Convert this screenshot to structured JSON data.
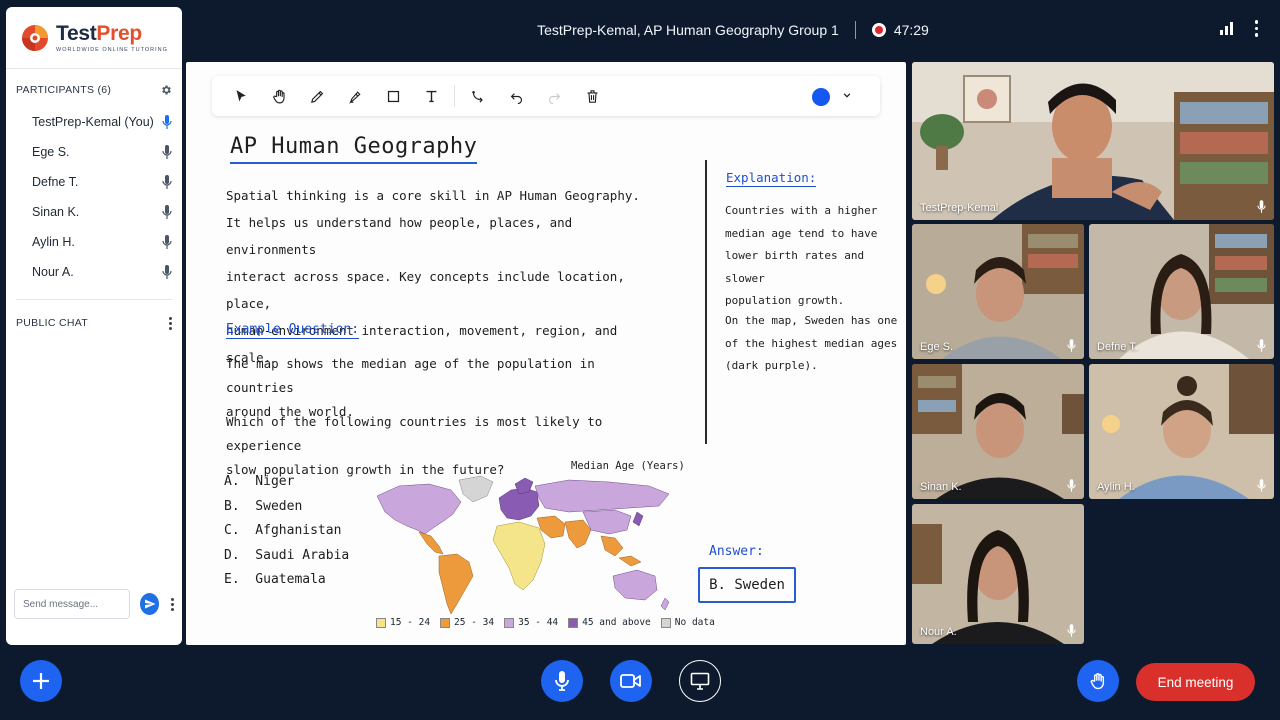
{
  "meeting": {
    "title": "TestPrep-Kemal, AP Human Geography Group 1",
    "timer": "47:29"
  },
  "brand": {
    "name_part1": "Test",
    "name_part2": "Prep",
    "tagline": "WORLDWIDE ONLINE TUTORING"
  },
  "participants": {
    "header": "PARTICIPANTS (6)",
    "list": [
      {
        "name": "TestPrep-Kemal (You)",
        "mic_color": "#1f6fe5"
      },
      {
        "name": "Ege S.",
        "mic_color": "#4b5563"
      },
      {
        "name": "Defne T.",
        "mic_color": "#4b5563"
      },
      {
        "name": "Sinan K.",
        "mic_color": "#4b5563"
      },
      {
        "name": "Aylin H.",
        "mic_color": "#4b5563"
      },
      {
        "name": "Nour A.",
        "mic_color": "#4b5563"
      }
    ]
  },
  "chat": {
    "header": "PUBLIC CHAT",
    "placeholder": "Send message..."
  },
  "board": {
    "title": "AP Human Geography",
    "intro_lines": [
      "Spatial thinking is a core skill in AP Human Geography.",
      "It helps us understand how people, places, and environments",
      "interact across space. Key concepts include location, place,",
      "human-environment interaction, movement, region, and scale."
    ],
    "example_label": "Example Question:",
    "question_lines": [
      "The map shows the median age of the population in countries",
      "around the world."
    ],
    "question2_lines": [
      "Which of the following countries is most likely to experience",
      "slow population growth in the future?"
    ],
    "options": [
      "A.  Niger",
      "B.  Sweden",
      "C.  Afghanistan",
      "D.  Saudi Arabia",
      "E.  Guatemala"
    ],
    "explanation_label": "Explanation:",
    "explanation_lines_1": [
      "Countries with a higher",
      "median age tend to have",
      "lower birth rates and slower",
      "population growth."
    ],
    "explanation_lines_2": [
      "On the map, Sweden has one",
      "of the highest median ages",
      "(dark purple)."
    ],
    "map_title": "Median Age (Years)",
    "legend": [
      {
        "label": "15 - 24",
        "color": "#f5e58a"
      },
      {
        "label": "25 - 34",
        "color": "#ec9a3c"
      },
      {
        "label": "35 - 44",
        "color": "#c9a6dc"
      },
      {
        "label": "45 and above",
        "color": "#8a5bb3"
      },
      {
        "label": "No data",
        "color": "#d5d5d5"
      }
    ],
    "answer_label": "Answer:",
    "answer": "B.  Sweden"
  },
  "tiles": [
    {
      "name": "TestPrep-Kemal"
    },
    {
      "name": "Ege S."
    },
    {
      "name": "Defne T."
    },
    {
      "name": "Sinan K."
    },
    {
      "name": "Aylin H."
    },
    {
      "name": "Nour A."
    }
  ],
  "controls": {
    "end_label": "End meeting"
  },
  "colors": {
    "accent": "#1e64f0",
    "end": "#d9302b",
    "background": "#0d1a2e"
  }
}
